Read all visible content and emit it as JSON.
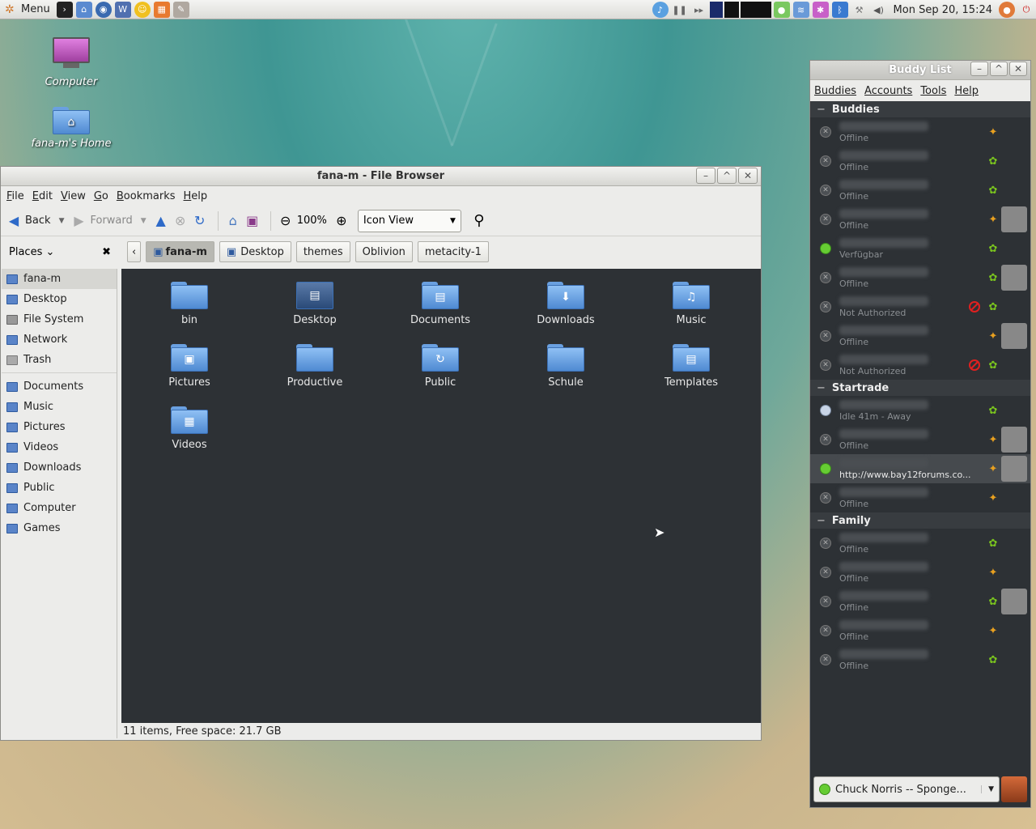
{
  "top_panel": {
    "menu_label": "Menu",
    "clock": "Mon Sep 20, 15:24"
  },
  "desktop": {
    "icons": [
      {
        "label": "Computer"
      },
      {
        "label": "fana-m's Home"
      }
    ]
  },
  "file_browser": {
    "title": "fana-m - File Browser",
    "menu": [
      "File",
      "Edit",
      "View",
      "Go",
      "Bookmarks",
      "Help"
    ],
    "toolbar": {
      "back": "Back",
      "forward": "Forward",
      "zoom": "100%",
      "view_mode": "Icon View"
    },
    "places_label": "Places",
    "path": [
      "fana-m",
      "Desktop",
      "themes",
      "Oblivion",
      "metacity-1"
    ],
    "sidebar_primary": [
      "fana-m",
      "Desktop",
      "File System",
      "Network",
      "Trash"
    ],
    "sidebar_bookmarks": [
      "Documents",
      "Music",
      "Pictures",
      "Videos",
      "Downloads",
      "Public",
      "Computer",
      "Games"
    ],
    "files": [
      "bin",
      "Desktop",
      "Documents",
      "Downloads",
      "Music",
      "Pictures",
      "Productive",
      "Public",
      "Schule",
      "Templates",
      "Videos"
    ],
    "status": "11 items, Free space: 21.7 GB"
  },
  "buddy_list": {
    "title": "Buddy List",
    "menu": [
      "Buddies",
      "Accounts",
      "Tools",
      "Help"
    ],
    "groups": [
      {
        "name": "Buddies",
        "buddies": [
          {
            "status_text": "Offline",
            "state": "offline",
            "proto": "msn"
          },
          {
            "status_text": "Offline",
            "state": "offline",
            "proto": "icq"
          },
          {
            "status_text": "Offline",
            "state": "offline",
            "proto": "icq"
          },
          {
            "status_text": "Offline",
            "state": "offline",
            "proto": "msn"
          },
          {
            "status_text": "Verfügbar",
            "state": "online",
            "proto": "icq"
          },
          {
            "status_text": "Offline",
            "state": "offline",
            "proto": "icq"
          },
          {
            "status_text": "Not Authorized",
            "state": "offline",
            "proto": "icq"
          },
          {
            "status_text": "Offline",
            "state": "offline",
            "proto": "msn"
          },
          {
            "status_text": "Not Authorized",
            "state": "offline",
            "proto": "icq"
          }
        ]
      },
      {
        "name": "Startrade",
        "buddies": [
          {
            "status_text": "Idle 41m - Away",
            "state": "idle",
            "proto": "icq"
          },
          {
            "status_text": "Offline",
            "state": "offline",
            "proto": "msn"
          },
          {
            "status_text": "http://www.bay12forums.co...",
            "state": "online",
            "proto": "msn"
          },
          {
            "status_text": "Offline",
            "state": "offline",
            "proto": "msn"
          }
        ]
      },
      {
        "name": "Family",
        "buddies": [
          {
            "status_text": "Offline",
            "state": "offline",
            "proto": "icq"
          },
          {
            "status_text": "Offline",
            "state": "offline",
            "proto": "msn"
          },
          {
            "status_text": "Offline",
            "state": "offline",
            "proto": "icq"
          },
          {
            "status_text": "Offline",
            "state": "offline",
            "proto": "msn"
          },
          {
            "status_text": "Offline",
            "state": "offline",
            "proto": "icq"
          }
        ]
      }
    ],
    "status_message": "Chuck Norris -- Sponge..."
  }
}
